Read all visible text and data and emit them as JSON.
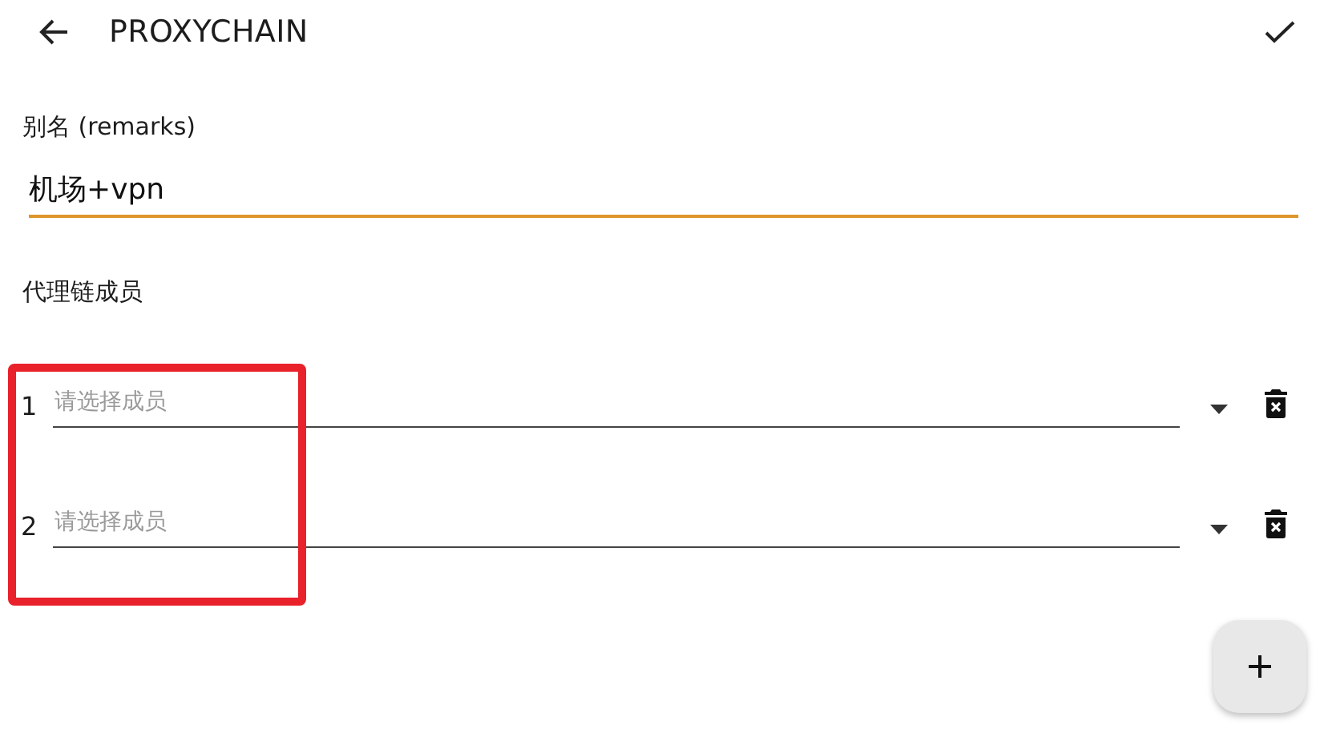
{
  "app_bar": {
    "title": "PROXYCHAIN"
  },
  "remarks": {
    "label": "别名 (remarks)",
    "value": "机场+vpn",
    "focused": true
  },
  "members_heading": "代理链成员",
  "members": [
    {
      "index": "1",
      "placeholder": "请选择成员"
    },
    {
      "index": "2",
      "placeholder": "请选择成员"
    }
  ],
  "annotation": {
    "kind": "rectangle"
  }
}
